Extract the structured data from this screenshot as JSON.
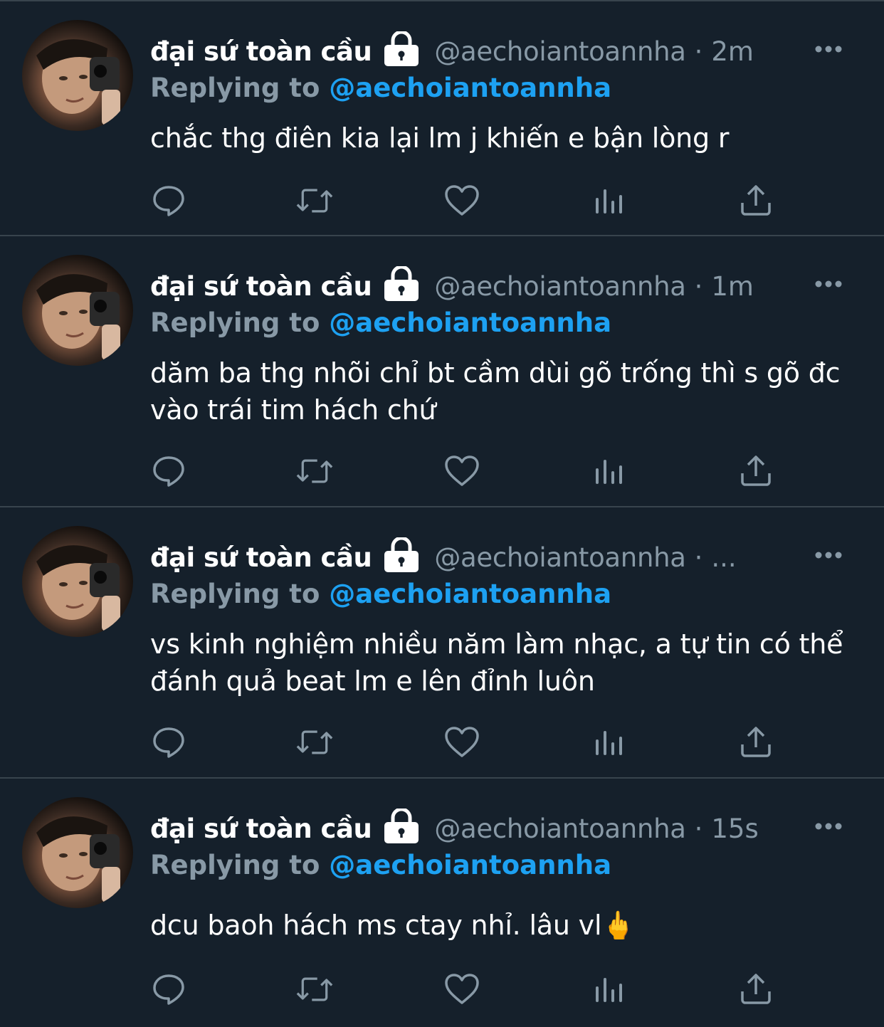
{
  "colors": {
    "background": "#15202b",
    "divider": "#38444d",
    "secondary_text": "#8899a6",
    "accent": "#1da1f2",
    "primary_text": "#ffffff"
  },
  "icons": {
    "lock": "lock-icon",
    "more": "more-dots-icon",
    "reply": "reply-icon",
    "retweet": "retweet-icon",
    "like": "heart-icon",
    "analytics": "analytics-icon",
    "share": "share-icon"
  },
  "tweets": [
    {
      "display_name": "đại sứ toàn cầu",
      "handle": "@aechoiantoannha",
      "separator": "·",
      "time": "2m",
      "replying_label": "Replying to",
      "replying_handle": "@aechoiantoannha",
      "text": "chắc thg điên kia lại lm j khiến e bận lòng r"
    },
    {
      "display_name": "đại sứ toàn cầu",
      "handle": "@aechoiantoannha",
      "separator": "·",
      "time": "1m",
      "replying_label": "Replying to",
      "replying_handle": "@aechoiantoannha",
      "text": "dăm ba thg nhõi chỉ bt cầm dùi gõ trống thì s gõ đc vào trái tim hách chứ"
    },
    {
      "display_name": "đại sứ toàn cầu",
      "handle": "@aechoiantoannha",
      "separator": "·",
      "time": "...",
      "replying_label": "Replying to",
      "replying_handle": "@aechoiantoannha",
      "text": "vs kinh nghiệm nhiều năm làm nhạc, a tự tin có thể đánh quả beat lm e lên đỉnh luôn"
    },
    {
      "display_name": "đại sứ toàn cầu",
      "handle": "@aechoiantoannha",
      "separator": "·",
      "time": "15s",
      "replying_label": "Replying to",
      "replying_handle": "@aechoiantoannha",
      "text": "dcu baoh hách ms ctay nhỉ. lâu vl🖕"
    }
  ]
}
